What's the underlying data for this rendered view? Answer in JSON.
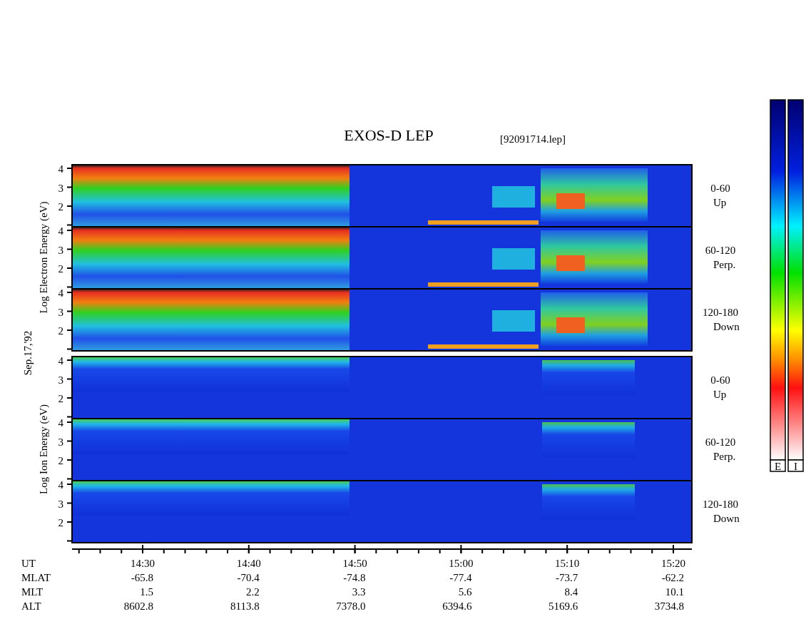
{
  "title": "EXOS-D LEP",
  "file": "[92091714.lep]",
  "date": "Sep.17,'92",
  "groups": [
    {
      "kind": "electron",
      "axis_label": "Log  Electron  Energy (eV)",
      "panels": [
        {
          "range": "0-60",
          "direction": "Up",
          "yticks": [
            "4",
            "3",
            "2"
          ]
        },
        {
          "range": "60-120",
          "direction": "Perp.",
          "yticks": [
            "4",
            "3",
            "2"
          ]
        },
        {
          "range": "120-180",
          "direction": "Down",
          "yticks": [
            "4",
            "3",
            "2"
          ]
        }
      ]
    },
    {
      "kind": "ion",
      "axis_label": "Log  Ion  Energy (eV)",
      "panels": [
        {
          "range": "0-60",
          "direction": "Up",
          "yticks": [
            "4",
            "3",
            "2"
          ]
        },
        {
          "range": "60-120",
          "direction": "Perp.",
          "yticks": [
            "4",
            "3",
            "2"
          ]
        },
        {
          "range": "120-180",
          "direction": "Down",
          "yticks": [
            "4",
            "3",
            "2"
          ]
        }
      ]
    }
  ],
  "colorbars": [
    {
      "label": "E"
    },
    {
      "label": "I"
    }
  ],
  "time_axis": {
    "label": "UT",
    "ticks": [
      "14:30",
      "14:40",
      "14:50",
      "15:00",
      "15:10",
      "15:20"
    ]
  },
  "rows": [
    {
      "label": "MLAT",
      "values": [
        "-65.8",
        "-70.4",
        "-74.8",
        "-77.4",
        "-73.7",
        "-62.2"
      ]
    },
    {
      "label": "MLT",
      "values": [
        "1.5",
        "2.2",
        "3.3",
        "5.6",
        "8.4",
        "10.1"
      ]
    },
    {
      "label": "ALT",
      "values": [
        "8602.8",
        "8113.8",
        "7378.0",
        "6394.6",
        "5169.6",
        "3734.8"
      ]
    }
  ]
}
